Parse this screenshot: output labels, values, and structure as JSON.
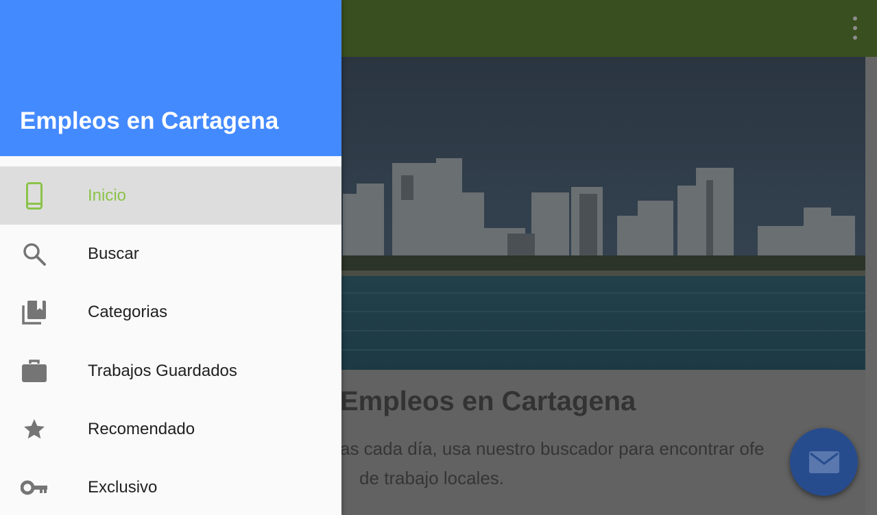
{
  "colors": {
    "drawer_header": "#448aff",
    "active_accent": "#8bc34a",
    "toolbar": "#3a4f1f",
    "fab": "#274c8e"
  },
  "toolbar": {
    "overflow_icon": "more-vert-icon"
  },
  "main": {
    "title": "Empleos en Cartagena",
    "body_line1": "as cada día, usa nuestro buscador para encontrar ofe",
    "body_line2": "de trabajo locales.",
    "fab_icon": "mail-icon"
  },
  "drawer": {
    "title": "Empleos en Cartagena",
    "items": [
      {
        "label": "Inicio",
        "icon": "phone-icon",
        "active": true
      },
      {
        "label": "Buscar",
        "icon": "search-icon",
        "active": false
      },
      {
        "label": "Categorias",
        "icon": "collections-bookmark-icon",
        "active": false
      },
      {
        "label": "Trabajos Guardados",
        "icon": "briefcase-icon",
        "active": false
      },
      {
        "label": "Recomendado",
        "icon": "star-icon",
        "active": false
      },
      {
        "label": "Exclusivo",
        "icon": "key-icon",
        "active": false
      }
    ]
  }
}
